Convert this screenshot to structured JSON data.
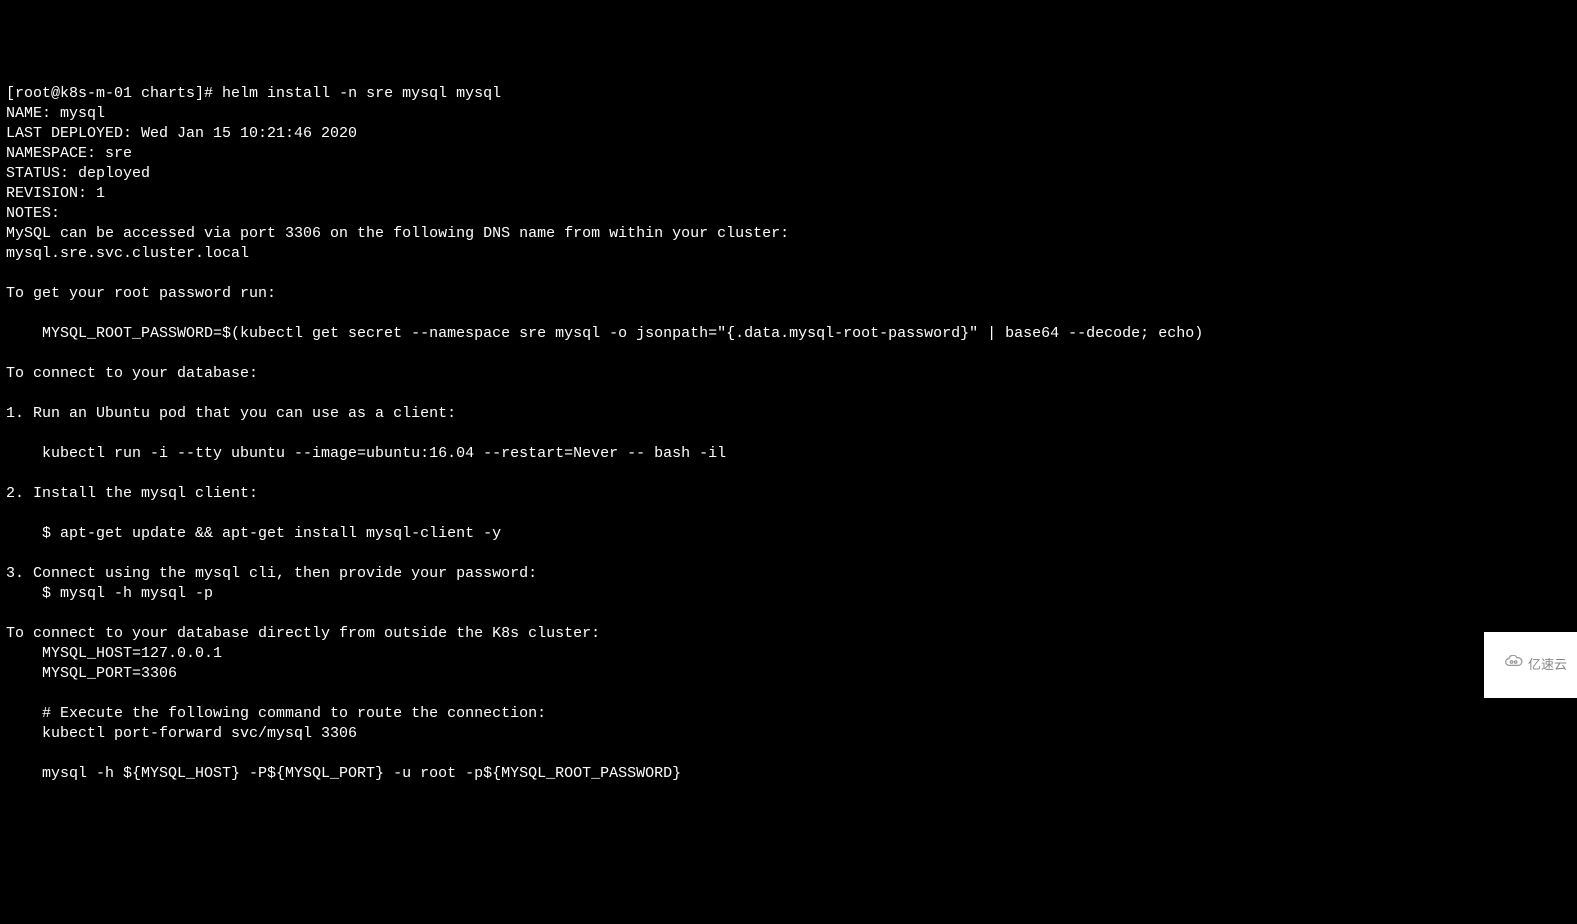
{
  "terminal": {
    "prompt": "[root@k8s-m-01 charts]# ",
    "command": "helm install -n sre mysql mysql",
    "lines": {
      "name": "NAME: mysql",
      "last_deployed": "LAST DEPLOYED: Wed Jan 15 10:21:46 2020",
      "namespace": "NAMESPACE: sre",
      "status": "STATUS: deployed",
      "revision": "REVISION: 1",
      "notes_header": "NOTES:",
      "access_note": "MySQL can be accessed via port 3306 on the following DNS name from within your cluster:",
      "dns_name": "mysql.sre.svc.cluster.local",
      "empty1": "",
      "root_pw_header": "To get your root password run:",
      "empty2": "",
      "root_pw_cmd": "    MYSQL_ROOT_PASSWORD=$(kubectl get secret --namespace sre mysql -o jsonpath=\"{.data.mysql-root-password}\" | base64 --decode; echo)",
      "empty3": "",
      "connect_header": "To connect to your database:",
      "empty4": "",
      "step1": "1. Run an Ubuntu pod that you can use as a client:",
      "empty5": "",
      "step1_cmd": "    kubectl run -i --tty ubuntu --image=ubuntu:16.04 --restart=Never -- bash -il",
      "empty6": "",
      "step2": "2. Install the mysql client:",
      "empty7": "",
      "step2_cmd": "    $ apt-get update && apt-get install mysql-client -y",
      "empty8": "",
      "step3": "3. Connect using the mysql cli, then provide your password:",
      "step3_cmd": "    $ mysql -h mysql -p",
      "empty9": "",
      "outside_header": "To connect to your database directly from outside the K8s cluster:",
      "mysql_host": "    MYSQL_HOST=127.0.0.1",
      "mysql_port": "    MYSQL_PORT=3306",
      "empty10": "",
      "route_comment": "    # Execute the following command to route the connection:",
      "port_forward": "    kubectl port-forward svc/mysql 3306",
      "empty11": "",
      "final_cmd": "    mysql -h ${MYSQL_HOST} -P${MYSQL_PORT} -u root -p${MYSQL_ROOT_PASSWORD}"
    }
  },
  "watermark": {
    "text": "亿速云"
  }
}
